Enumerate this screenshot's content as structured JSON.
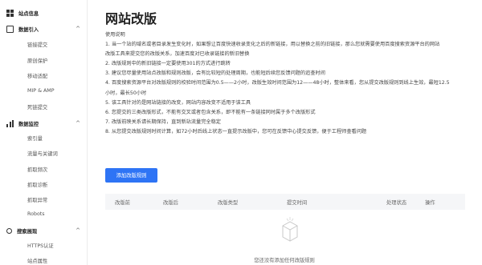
{
  "sidebar": {
    "top_item": "站点信息",
    "groups": [
      {
        "title": "数据引入",
        "chevron": "^",
        "items": [
          "链接提交",
          "原创保护",
          "移动适配",
          "MIP & AMP",
          "死链提交"
        ]
      },
      {
        "title": "数据监控",
        "chevron": "^",
        "items": [
          "索引量",
          "流量与关键词",
          "抓取频次",
          "抓取诊断",
          "抓取异常",
          "Robots"
        ]
      },
      {
        "title": "搜索展现",
        "chevron": "^",
        "items": [
          "HTTPS认证",
          "站点属性"
        ]
      }
    ],
    "icons": {
      "top": "grid-icon",
      "group0": "doc-icon",
      "group1": "bar-chart-icon",
      "group2": "search-icon"
    }
  },
  "main": {
    "title": "网站改版",
    "instructions": [
      "使用说明",
      "1. 当一个站的域名或者目录发生变化时，如果想让百度快速收录变化之后的新链接，用以替换之前的旧链接，那么您就需要使用百度搜索资源平台的网站",
      "改版工具来提交您的改版关系，加速百度对已收录链接的新旧替换",
      "2. 改版规则中的新旧链接一定要使用301的方式进行跳转",
      "3. 建议您尽量使用站点改版和规则改版，会有比较短的处理周期，也能短后续您反馈问题的追查时间",
      "4. 百度搜索资源平台对改版规则的校验时间范围为0.5——2小时，改版生效时间范围为12——48小时，整体来看，您从提交改版规则到线上生效，最短12.5",
      "小时，最长50小时",
      "5. 该工具针对的是网站链接的改变，网站内容改变不适用于该工具",
      "6. 您提交的三类改版形式，不能有交叉或者包含关系，即不能有一条链接同时属于多个改版形式",
      "7. 改版前映关系请长期保持，直到新站流量完全稳定",
      "8. 从您提交改版规则时间计算，如72小时后线上状态一直提示改版中，您可在反馈中心提交反馈，便于工程师查看问题"
    ],
    "add_button": "添加改版规则",
    "table": {
      "columns": [
        "改版前",
        "改版后",
        "改版类型",
        "提交时间",
        "处理状态",
        "操作"
      ]
    },
    "empty_text": "您还没有添加任何改版规则",
    "empty_icon": "empty-box-icon",
    "accent_color": "#2e74f5"
  }
}
